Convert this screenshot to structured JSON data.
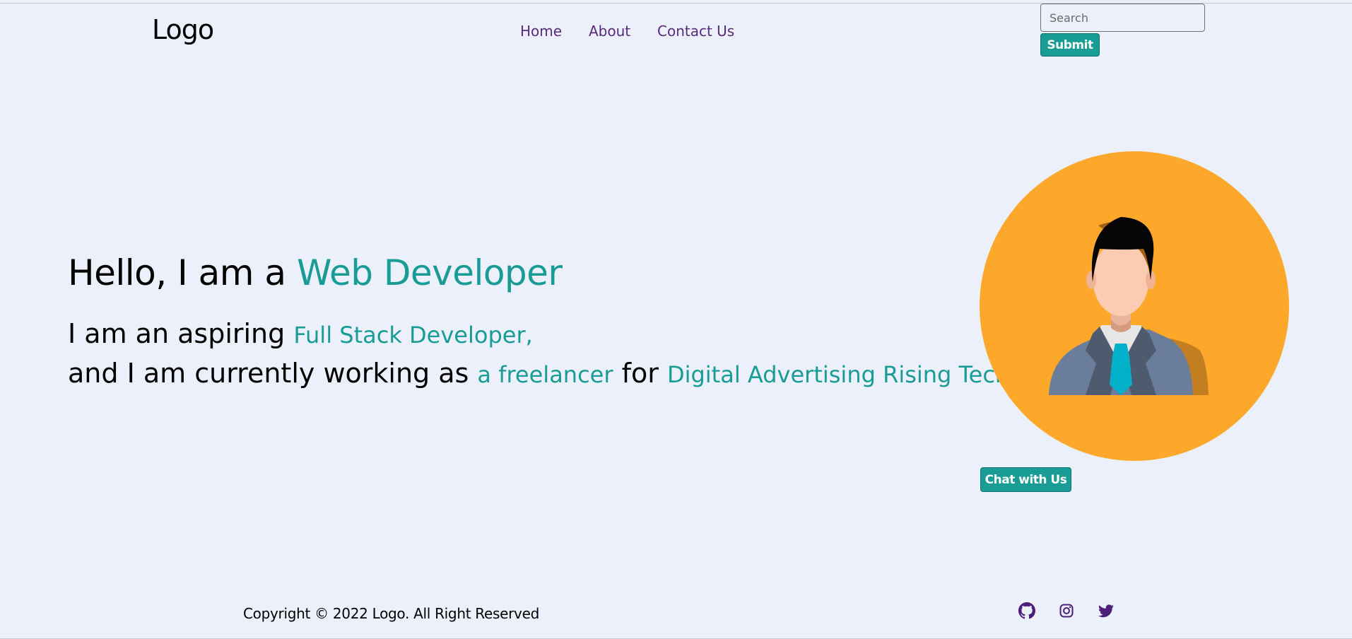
{
  "header": {
    "logo": "Logo",
    "nav": {
      "home": "Home",
      "about": "About",
      "contact": "Contact Us"
    },
    "search": {
      "placeholder": "Search",
      "value": ""
    },
    "submit_label": "Submit"
  },
  "hero": {
    "title_prefix": "Hello, I am a ",
    "title_accent": "Web Developer",
    "line1_prefix": "I am an aspiring ",
    "line1_accent": "Full Stack Developer,",
    "line2_prefix": "and I am currently working as ",
    "line2_accent1": "a freelancer",
    "line2_mid": " for ",
    "line2_accent2": "Digital Advertising Rising Tech"
  },
  "chat_label": "Chat with Us",
  "footer": {
    "copyright": "Copyright © 2022 Logo. All Right Reserved",
    "social": [
      "github-icon",
      "instagram-icon",
      "twitter-icon"
    ]
  },
  "colors": {
    "accent": "#189c95",
    "nav": "#5a2a7a",
    "background": "#ecf0fb",
    "avatar_bg": "#fda82a"
  }
}
